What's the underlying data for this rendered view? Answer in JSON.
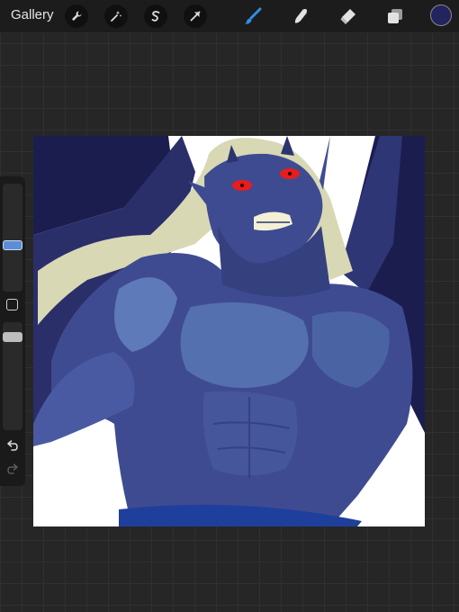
{
  "toolbar": {
    "gallery_label": "Gallery",
    "actions_icon": "wrench-icon",
    "adjustments_icon": "magic-wand-icon",
    "selection_icon": "selection-s-icon",
    "transform_icon": "arrow-cursor-icon",
    "brush_icon": "brush-icon",
    "smudge_icon": "smudge-icon",
    "eraser_icon": "eraser-icon",
    "layers_icon": "layers-icon",
    "active_tool": "brush",
    "active_color": "#22245e"
  },
  "sidebar": {
    "brush_size_level": 0.35,
    "opacity_level": 0.1,
    "undo_icon": "undo-icon",
    "redo_icon": "redo-icon"
  },
  "canvas": {
    "background": "#ffffff",
    "palette": {
      "night": "#1a1d4e",
      "skin": "#3f4b91",
      "skin_shadow": "#2c3470",
      "highlight": "#5e7ab8",
      "hair": "#d8d8b4",
      "eyes": "#e81c1c",
      "belt": "#1f3f9c"
    }
  }
}
